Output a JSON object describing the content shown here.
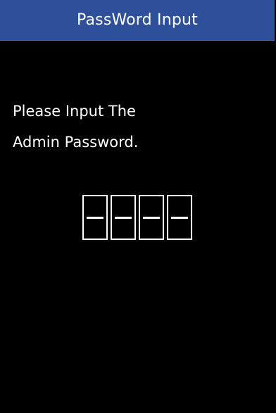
{
  "header": {
    "title": "PassWord Input"
  },
  "prompt": {
    "line1": "Please Input The",
    "line2": "Admin Password."
  },
  "password_field": {
    "digit_count": 4,
    "entered_count": 0,
    "placeholder_glyph": "-"
  },
  "colors": {
    "header_background": "#2e4f9a",
    "screen_background": "#000000",
    "text": "#ffffff"
  }
}
